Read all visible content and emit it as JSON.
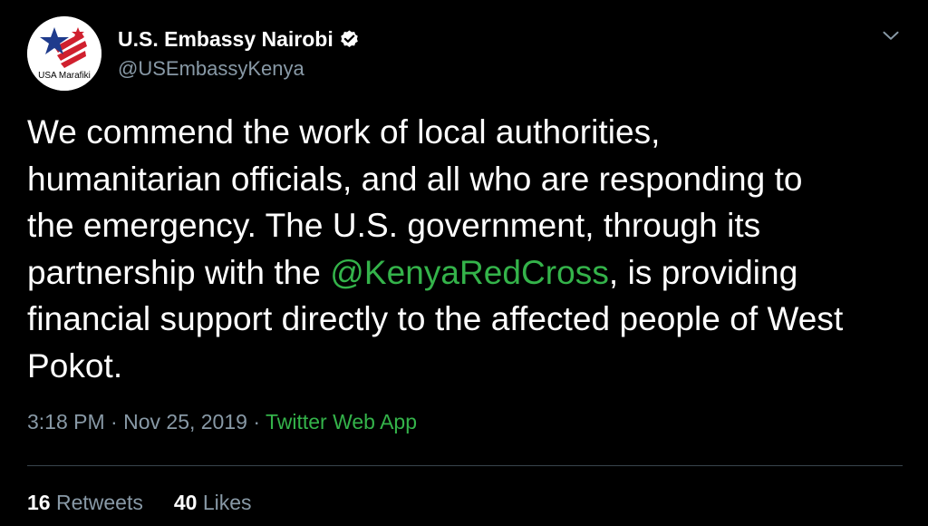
{
  "author": {
    "display_name": "U.S. Embassy Nairobi",
    "handle": "@USEmbassyKenya",
    "avatar_text": "USA Marafiki",
    "verified": true
  },
  "tweet": {
    "text_before": "We commend the work of local authorities,\nhumanitarian officials, and all who are responding to\nthe emergency. The U.S. government, through its\npartnership with the ",
    "mention": "@KenyaRedCross",
    "text_after": ", is providing\nfinancial support directly to the affected people of West\nPokot."
  },
  "meta": {
    "time": "3:18 PM",
    "separator": " · ",
    "date": "Nov 25, 2019",
    "source": "Twitter Web App"
  },
  "stats": {
    "retweets_count": "16",
    "retweets_label": "Retweets",
    "likes_count": "40",
    "likes_label": "Likes"
  },
  "colors": {
    "background": "#000000",
    "link": "#34b34a",
    "secondary_text": "#8899a6"
  },
  "icons": {
    "verified": "verified-badge-icon",
    "menu": "chevron-down-icon"
  }
}
